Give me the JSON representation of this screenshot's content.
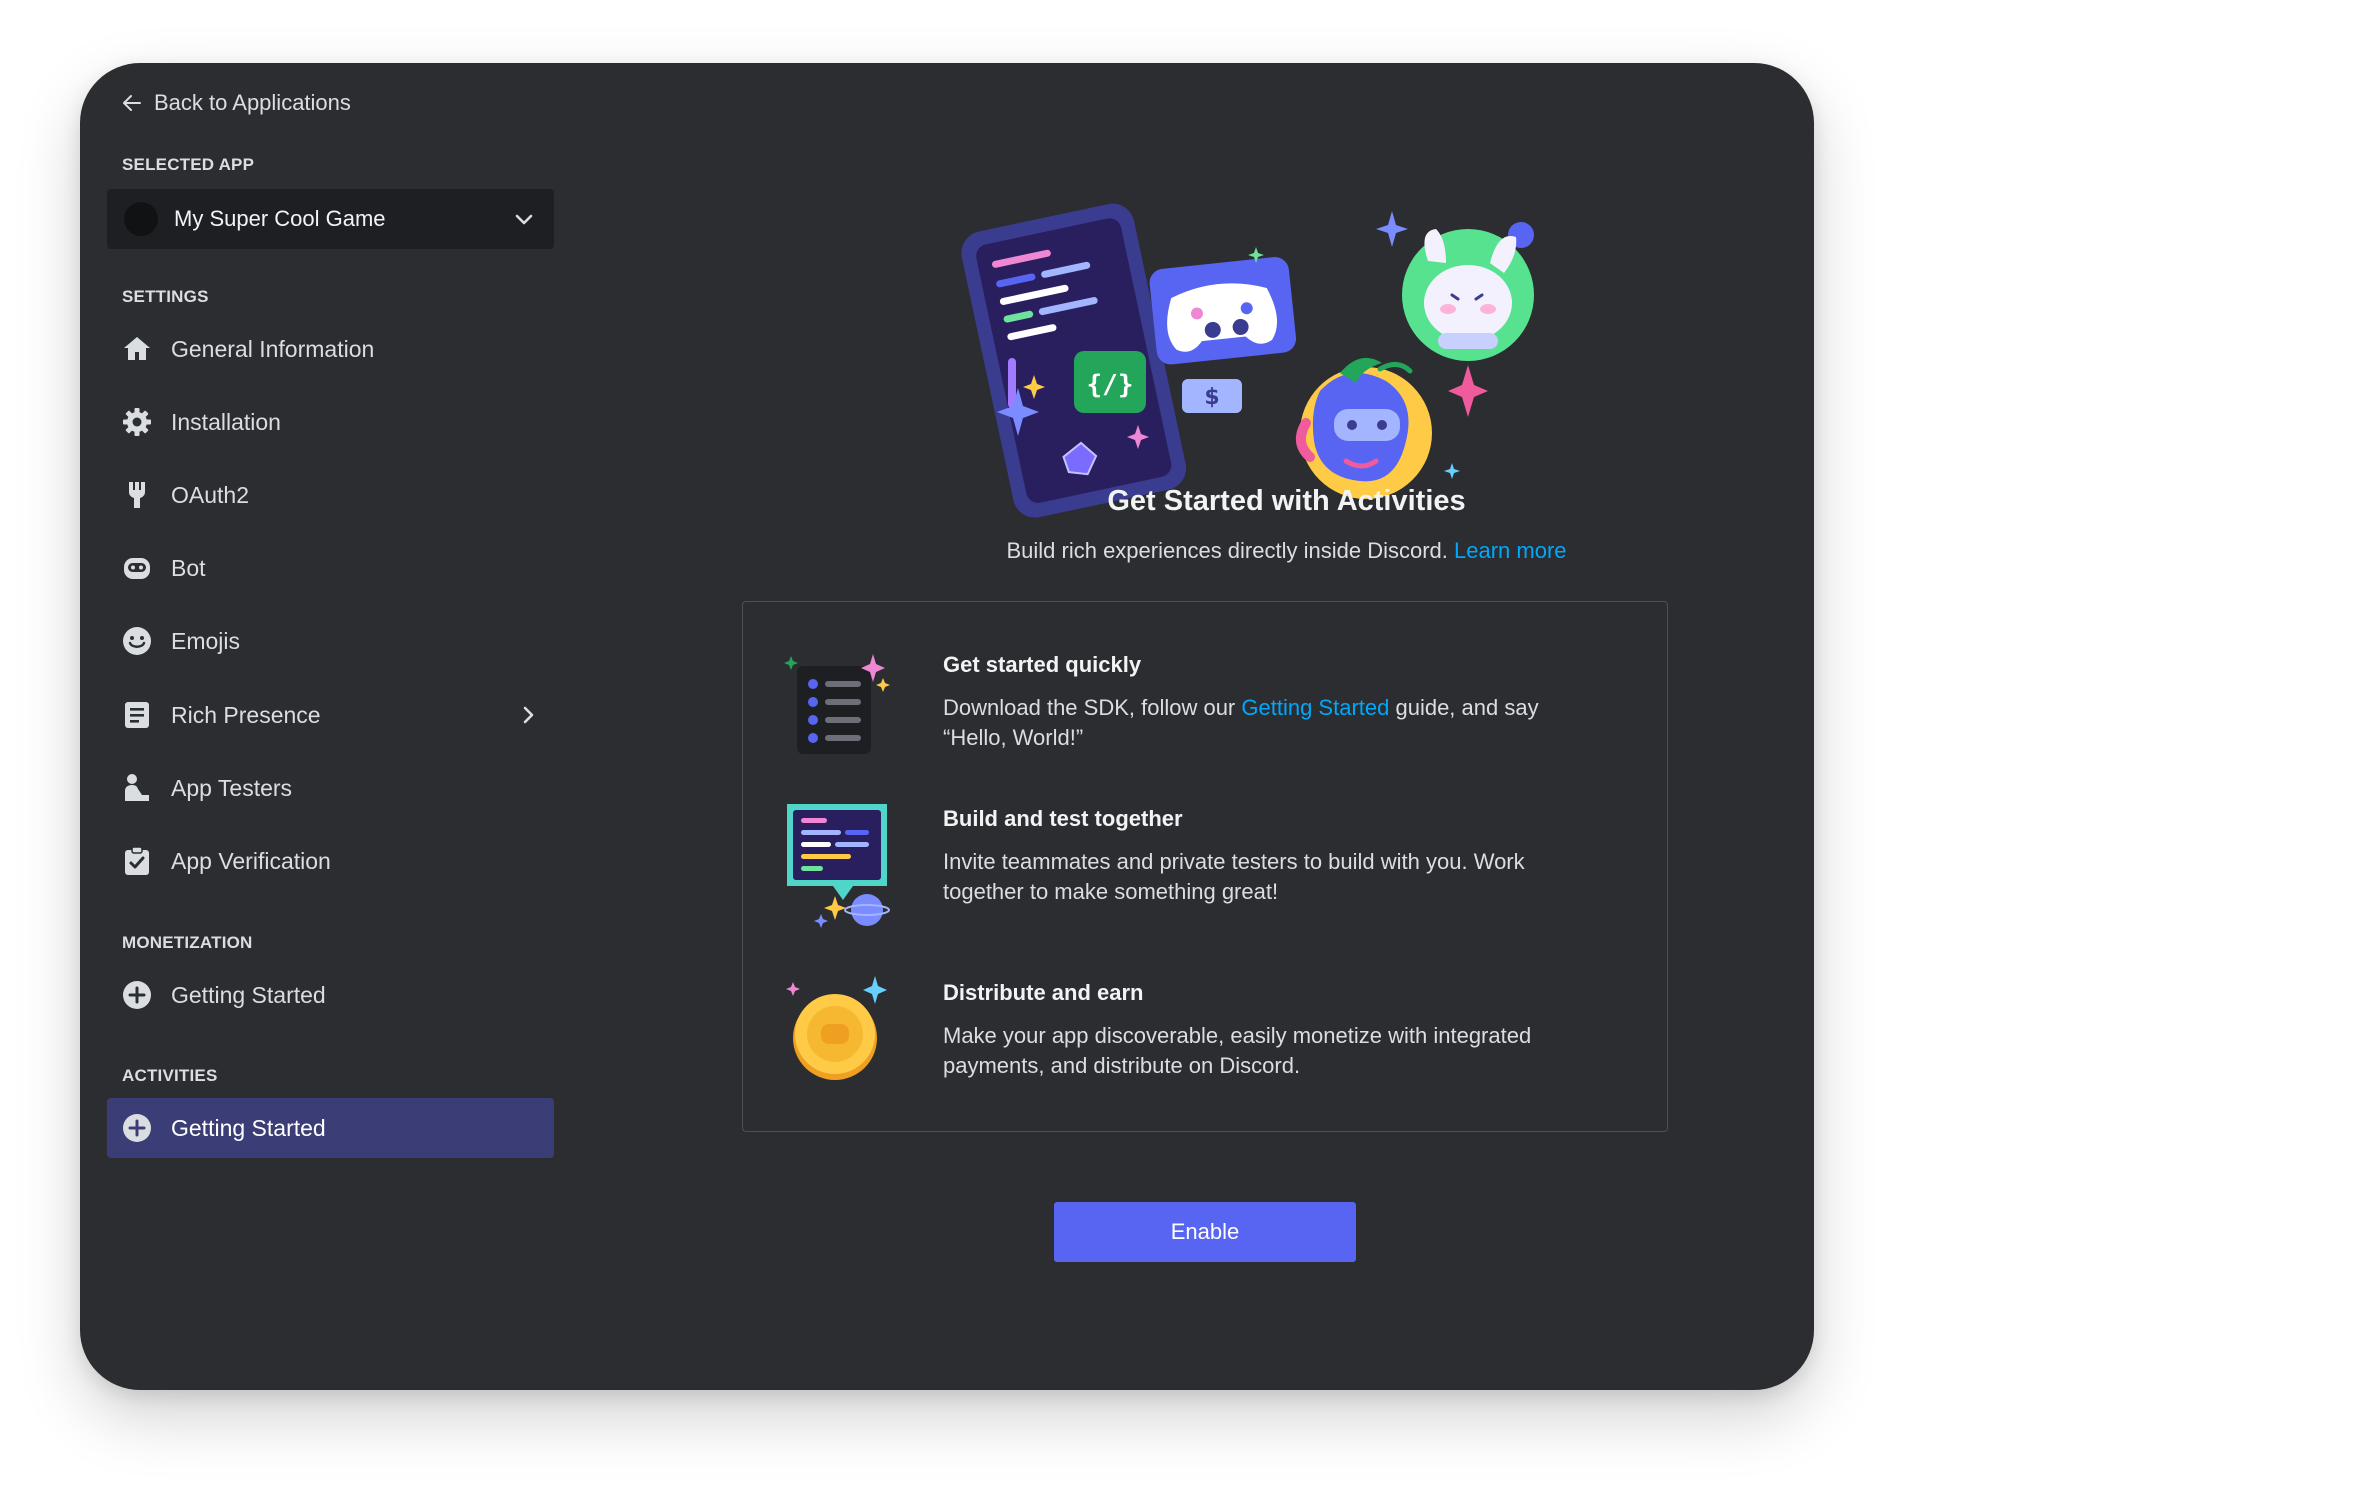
{
  "sidebar": {
    "back_label": "Back to Applications",
    "selected_app_heading": "SELECTED APP",
    "selected_app_name": "My Super Cool Game",
    "settings_heading": "SETTINGS",
    "settings_items": [
      {
        "label": "General Information",
        "icon": "home-icon"
      },
      {
        "label": "Installation",
        "icon": "gear-icon"
      },
      {
        "label": "OAuth2",
        "icon": "wrench-icon"
      },
      {
        "label": "Bot",
        "icon": "robot-icon"
      },
      {
        "label": "Emojis",
        "icon": "smiley-icon"
      },
      {
        "label": "Rich Presence",
        "icon": "document-icon"
      },
      {
        "label": "App Testers",
        "icon": "person-icon"
      },
      {
        "label": "App Verification",
        "icon": "clipboard-check-icon"
      }
    ],
    "monetization_heading": "MONETIZATION",
    "monetization_items": [
      {
        "label": "Getting Started",
        "icon": "plus-circle-icon"
      }
    ],
    "activities_heading": "ACTIVITIES",
    "activities_items": [
      {
        "label": "Getting Started",
        "icon": "plus-circle-icon",
        "active": true
      }
    ]
  },
  "main": {
    "title": "Get Started with Activities",
    "subtitle": "Build rich experiences directly inside Discord.",
    "subtitle_link": "Learn more",
    "features": [
      {
        "title": "Get started quickly",
        "desc_before": "Download the SDK, follow our ",
        "desc_link": "Getting Started",
        "desc_after": " guide, and say “Hello, World!”",
        "icon": "checklist-icon"
      },
      {
        "title": "Build and test together",
        "desc": "Invite teammates and private testers to build with you. Work together to make something great!",
        "icon": "chat-screen-icon"
      },
      {
        "title": "Distribute and earn",
        "desc": "Make your app discoverable, easily monetize with integrated payments, and distribute on Discord.",
        "icon": "coin-icon"
      }
    ],
    "enable_label": "Enable"
  },
  "colors": {
    "window_bg": "#2b2d31",
    "select_bg": "#1e1f22",
    "active_item_bg": "#3b3e76",
    "accent": "#5865f2",
    "link": "#00a8fc"
  }
}
